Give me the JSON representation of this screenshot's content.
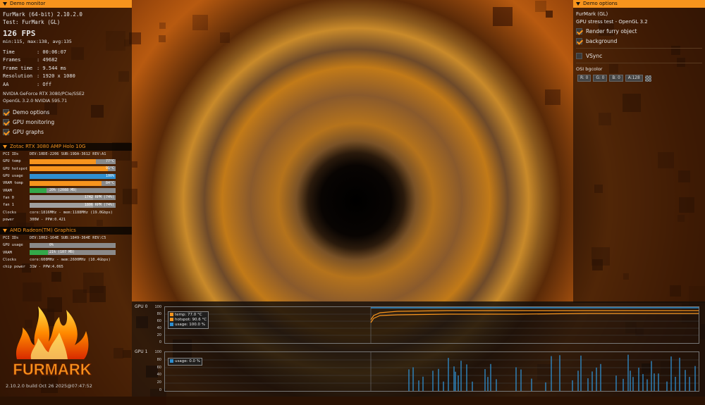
{
  "left_panel": {
    "header": "Demo monitor",
    "app": "FurMark (64-bit) 2.10.2.0",
    "test": "Test: FurMark (GL)",
    "fps": "126 FPS",
    "fps_stats": "min:115, max:138, avg:135",
    "stats": [
      {
        "key": "Time",
        "value": ": 00:06:07"
      },
      {
        "key": "Frames",
        "value": ": 49682"
      },
      {
        "key": "Frame time",
        "value": ": 9.544 ms"
      },
      {
        "key": "Resolution",
        "value": ": 1920 x 1080"
      },
      {
        "key": "AA",
        "value": ": Off"
      }
    ],
    "gpu_line": "NVIDIA GeForce RTX 3080/PCIe/SSE2",
    "opengl_line": "OpenGL 3.2.0 NVIDIA 595.71",
    "checks": [
      {
        "label": "Demo options",
        "checked": true
      },
      {
        "label": "GPU monitoring",
        "checked": true
      },
      {
        "label": "GPU graphs",
        "checked": true
      }
    ]
  },
  "gpu0": {
    "title": "Zotac RTX 3080 AMP Holo 10G",
    "pci_key": "PCI IDs",
    "pci": "DEV:10DE-2206 SUB:19DA-3612 REV:A1",
    "bars": [
      {
        "key": "GPU temp",
        "label": "77°C",
        "fill": 0.77,
        "color": "#f7941d"
      },
      {
        "key": "GPU hotspot",
        "label": "91°C",
        "fill": 0.91,
        "color": "#f7941d"
      },
      {
        "key": "GPU usage",
        "label": "100%",
        "fill": 1.0,
        "color": "#2f8fd0"
      },
      {
        "key": "VRAM temp",
        "label": "84°C",
        "fill": 0.84,
        "color": "#f7941d"
      },
      {
        "key": "VRAM",
        "label": "20% (2088 MB)",
        "fill": 0.2,
        "color": "#33a84a"
      },
      {
        "key": "fan 0",
        "label": "1742 RPM (74%)",
        "fill": 0.74,
        "color": "#a0a0a0"
      },
      {
        "key": "fan 1",
        "label": "1806 RPM (74%)",
        "fill": 0.74,
        "color": "#a0a0a0"
      }
    ],
    "clocks_key": "Clocks",
    "clocks": "core:1816MHz - mem:1188MHz (19.0Gbps)",
    "power_key": "power",
    "power": "300W - PPW:0.421"
  },
  "gpu1": {
    "title": "AMD Radeon(TM) Graphics",
    "pci_key": "PCI IDs",
    "pci": "DEV:1002-164E SUB:1849-364E REV:C5",
    "bars": [
      {
        "key": "GPU usage",
        "label": "0%",
        "fill": 0.0,
        "color": "#2f8fd0"
      },
      {
        "key": "VRAM",
        "label": "21% (107 MB)",
        "fill": 0.21,
        "color": "#33a84a"
      }
    ],
    "clocks_key": "Clocks",
    "clocks": "core:600MHz - mem:2600MHz (10.4Gbps)",
    "power_key": "chip power",
    "power": "31W - PPW:4.065"
  },
  "logo_text": "FURMARK",
  "build": "2.10.2.0 build Oct 26 2025@07:47:52",
  "right_panel": {
    "header": "Demo options",
    "test_name": "FurMark (GL)",
    "desc": "GPU stress test - OpenGL 3.2",
    "checks": [
      {
        "label": "Render furry object",
        "checked": true
      },
      {
        "label": "background",
        "checked": true
      }
    ],
    "vsync": "VSync",
    "osi_label": "OSI bgcolor",
    "rgba": [
      "R: 0",
      "G: 0",
      "B: 0",
      "A:128"
    ]
  },
  "graph0": {
    "label": "GPU 0",
    "ticks": [
      "100",
      "80",
      "60",
      "40",
      "20",
      "0"
    ],
    "legend": [
      {
        "text": "temp: 77.0 °C",
        "color": "#f7941d"
      },
      {
        "text": "hotspot: 90.6 °C",
        "color": "#f7941d"
      },
      {
        "text": "usage: 100.0 %",
        "color": "#2f8fd0"
      }
    ]
  },
  "graph1": {
    "label": "GPU 1",
    "ticks": [
      "100",
      "80",
      "60",
      "40",
      "20",
      "0"
    ],
    "legend": [
      {
        "text": "usage: 0.0 %",
        "color": "#2f8fd0"
      }
    ]
  }
}
